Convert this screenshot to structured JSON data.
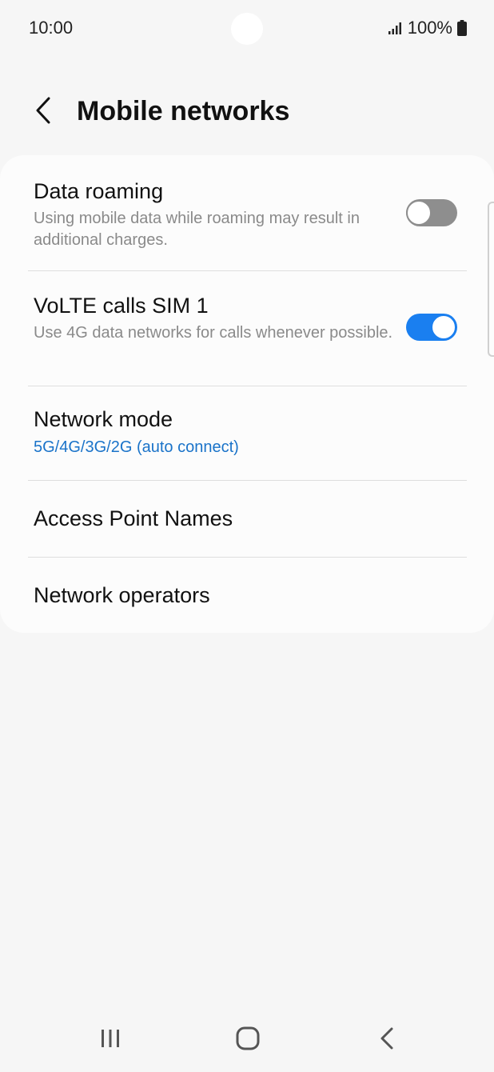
{
  "status_bar": {
    "time": "10:00",
    "battery_percent": "100%",
    "icons": [
      "signal-icon",
      "battery-icon"
    ]
  },
  "header": {
    "title": "Mobile networks",
    "back_icon": "chevron-left-icon"
  },
  "settings": {
    "data_roaming": {
      "title": "Data roaming",
      "subtitle": "Using mobile data while roaming may result in additional charges.",
      "enabled": false
    },
    "volte": {
      "title": "VoLTE calls SIM 1",
      "subtitle": "Use 4G data networks for calls whenever possible.",
      "enabled": true
    },
    "network_mode": {
      "title": "Network mode",
      "value": "5G/4G/3G/2G (auto connect)"
    },
    "apn": {
      "title": "Access Point Names"
    },
    "operators": {
      "title": "Network operators"
    }
  },
  "colors": {
    "accent": "#1a7ff0",
    "accent_text": "#1a73c9",
    "background": "#f6f6f6",
    "card": "#fcfcfc",
    "toggle_off": "#8e8e8e"
  },
  "nav_bar": {
    "icons": [
      "recent-apps-icon",
      "home-icon",
      "back-icon"
    ]
  }
}
